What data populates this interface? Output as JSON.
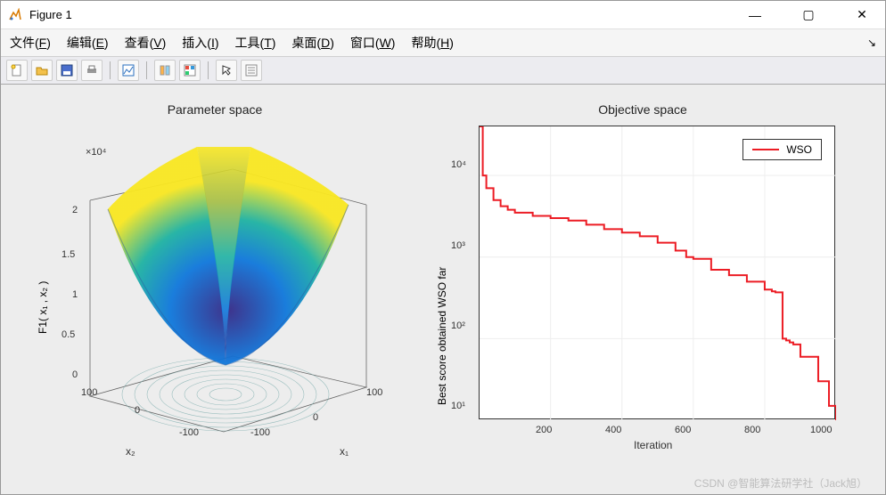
{
  "window": {
    "title": "Figure 1"
  },
  "menu": {
    "items": [
      {
        "label": "文件",
        "key": "F"
      },
      {
        "label": "编辑",
        "key": "E"
      },
      {
        "label": "查看",
        "key": "V"
      },
      {
        "label": "插入",
        "key": "I"
      },
      {
        "label": "工具",
        "key": "T"
      },
      {
        "label": "桌面",
        "key": "D"
      },
      {
        "label": "窗口",
        "key": "W"
      },
      {
        "label": "帮助",
        "key": "H"
      }
    ]
  },
  "toolbar": {
    "icons": [
      "new-file",
      "open-file",
      "save-file",
      "print",
      "sep",
      "link-plot",
      "sep",
      "data-cursor",
      "color-legend",
      "sep",
      "arrow",
      "plot-tools"
    ]
  },
  "left_plot": {
    "title": "Parameter space",
    "exponent": "×10⁴",
    "zlabel": "F1( x₁ , x₂ )",
    "xlabel": "x₁",
    "ylabel": "x₂",
    "zticks": [
      "0",
      "0.5",
      "1",
      "1.5",
      "2"
    ],
    "xticks": [
      "-100",
      "0",
      "100"
    ],
    "yticks": [
      "-100",
      "0",
      "100"
    ]
  },
  "right_plot": {
    "title": "Objective space",
    "xlabel": "Iteration",
    "ylabel": "Best score obtained WSO far",
    "legend": "WSO",
    "xticks": [
      "200",
      "400",
      "600",
      "800",
      "1000"
    ],
    "yticks": [
      "10¹",
      "10²",
      "10³",
      "10⁴"
    ]
  },
  "watermark": "CSDN @智能算法研学社（Jack旭）",
  "chart_data": [
    {
      "type": "surface3d",
      "title": "Parameter space",
      "xlabel": "x1",
      "ylabel": "x2",
      "zlabel": "F1(x1,x2)",
      "xrange": [
        -100,
        100
      ],
      "yrange": [
        -100,
        100
      ],
      "zrange": [
        0,
        20000
      ],
      "function": "F1 = x1^2 + x2^2",
      "colormap": "parula",
      "contours_on_floor": true
    },
    {
      "type": "line",
      "title": "Objective space",
      "xlabel": "Iteration",
      "ylabel": "Best score obtained WSO far",
      "xscale": "linear",
      "yscale": "log",
      "xlim": [
        1,
        1000
      ],
      "ylim": [
        10,
        40000
      ],
      "series": [
        {
          "name": "WSO",
          "color": "#ec1c24",
          "x": [
            1,
            10,
            20,
            40,
            60,
            80,
            100,
            150,
            200,
            250,
            300,
            350,
            400,
            450,
            500,
            550,
            580,
            600,
            650,
            700,
            750,
            800,
            820,
            830,
            850,
            860,
            870,
            880,
            900,
            950,
            980,
            1000
          ],
          "y": [
            40000,
            10000,
            7000,
            5000,
            4200,
            3800,
            3500,
            3200,
            3000,
            2800,
            2500,
            2200,
            2000,
            1800,
            1500,
            1200,
            1000,
            950,
            700,
            600,
            500,
            400,
            380,
            370,
            100,
            95,
            90,
            85,
            60,
            30,
            15,
            10
          ]
        }
      ]
    }
  ]
}
